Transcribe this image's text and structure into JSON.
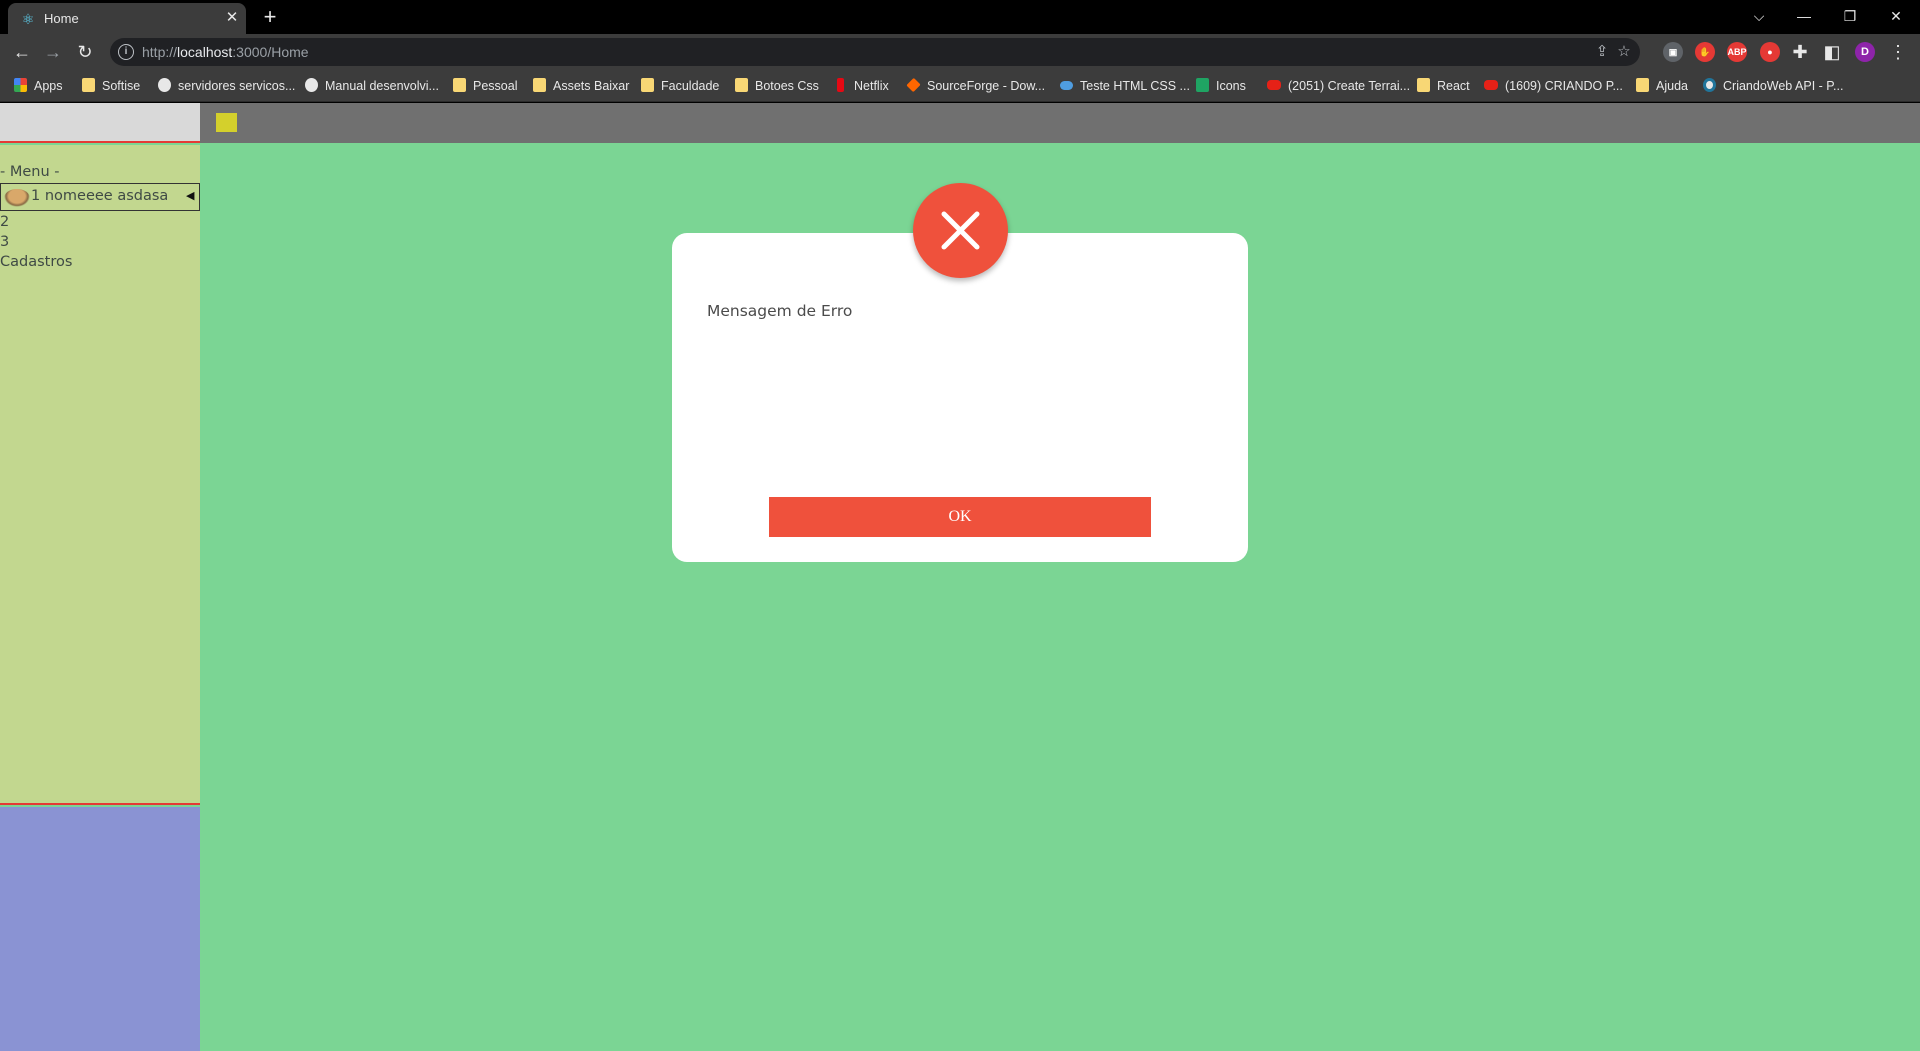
{
  "browser": {
    "tab": {
      "title": "Home",
      "favicon": "react-icon",
      "close": "✕"
    },
    "new_tab": "+",
    "window_controls": {
      "dropdown": "⌵",
      "minimize": "—",
      "restore": "❐",
      "close": "✕"
    },
    "address": {
      "scheme": "http://",
      "host": "localhost",
      "rest": ":3000/Home"
    },
    "bookmarks": [
      {
        "label": "Apps",
        "icon": "apps-grid-icon"
      },
      {
        "label": "Softise",
        "icon": "folder-icon"
      },
      {
        "label": "servidores servicos...",
        "icon": "globe-icon"
      },
      {
        "label": "Manual desenvolvi...",
        "icon": "globe-icon"
      },
      {
        "label": "Pessoal",
        "icon": "folder-icon"
      },
      {
        "label": "Assets Baixar",
        "icon": "folder-icon"
      },
      {
        "label": "Faculdade",
        "icon": "folder-icon"
      },
      {
        "label": "Botoes Css",
        "icon": "folder-icon"
      },
      {
        "label": "Netflix",
        "icon": "netflix-icon"
      },
      {
        "label": "SourceForge - Dow...",
        "icon": "sourceforge-icon"
      },
      {
        "label": "Teste HTML CSS ...",
        "icon": "cloud-icon"
      },
      {
        "label": "Icons",
        "icon": "sheets-icon"
      },
      {
        "label": "(2051) Create Terrai...",
        "icon": "youtube-icon"
      },
      {
        "label": "React",
        "icon": "folder-icon"
      },
      {
        "label": "(1609) CRIANDO P...",
        "icon": "youtube-icon"
      },
      {
        "label": "Ajuda",
        "icon": "folder-icon"
      },
      {
        "label": "CriandoWeb API - P...",
        "icon": "wordpress-icon"
      }
    ],
    "extensions": [
      {
        "name": "screen-recorder-extension-icon",
        "text": "▣",
        "color": "#5f6368"
      },
      {
        "name": "hand-extension-icon",
        "text": "✋",
        "color": "#e53935"
      },
      {
        "name": "adblock-extension-icon",
        "text": "ABP",
        "color": "#e53935"
      },
      {
        "name": "red-extension-icon",
        "text": "●",
        "color": "#e53935"
      }
    ],
    "profile_initial": "D"
  },
  "app": {
    "sidebar": {
      "menu_title": "- Menu -",
      "items": [
        "1 nomeeee asdasa",
        "2",
        "3",
        "Cadastros"
      ]
    },
    "modal": {
      "message": "Mensagem de Erro",
      "ok_label": "OK",
      "icon": "close-icon"
    },
    "colors": {
      "page_bg": "#7bd594",
      "sidebar_bg": "#c2d78f",
      "sidebar_bottom_bg": "#8a93d3",
      "header_bg": "#707070",
      "accent_red": "#ef513c",
      "header_square": "#d4d02c"
    }
  }
}
